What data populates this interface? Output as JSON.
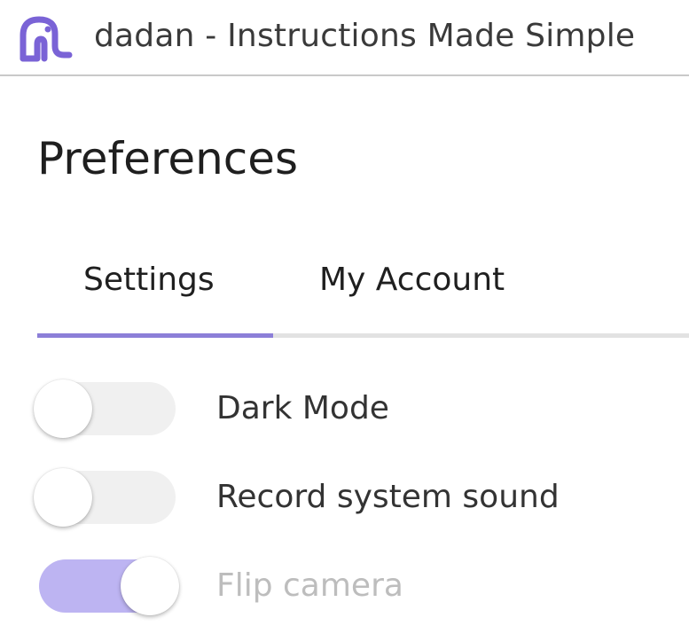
{
  "app": {
    "title": "dadan - Instructions Made Simple",
    "logo_icon": "dadan-logo-icon",
    "accent_color": "#8c7fd8"
  },
  "page": {
    "title": "Preferences"
  },
  "tabs": [
    {
      "label": "Settings",
      "active": true
    },
    {
      "label": "My Account",
      "active": false
    }
  ],
  "settings": [
    {
      "label": "Dark Mode",
      "on": false
    },
    {
      "label": "Record system sound",
      "on": false
    },
    {
      "label": "Flip camera",
      "on": true,
      "disabled": true
    }
  ]
}
